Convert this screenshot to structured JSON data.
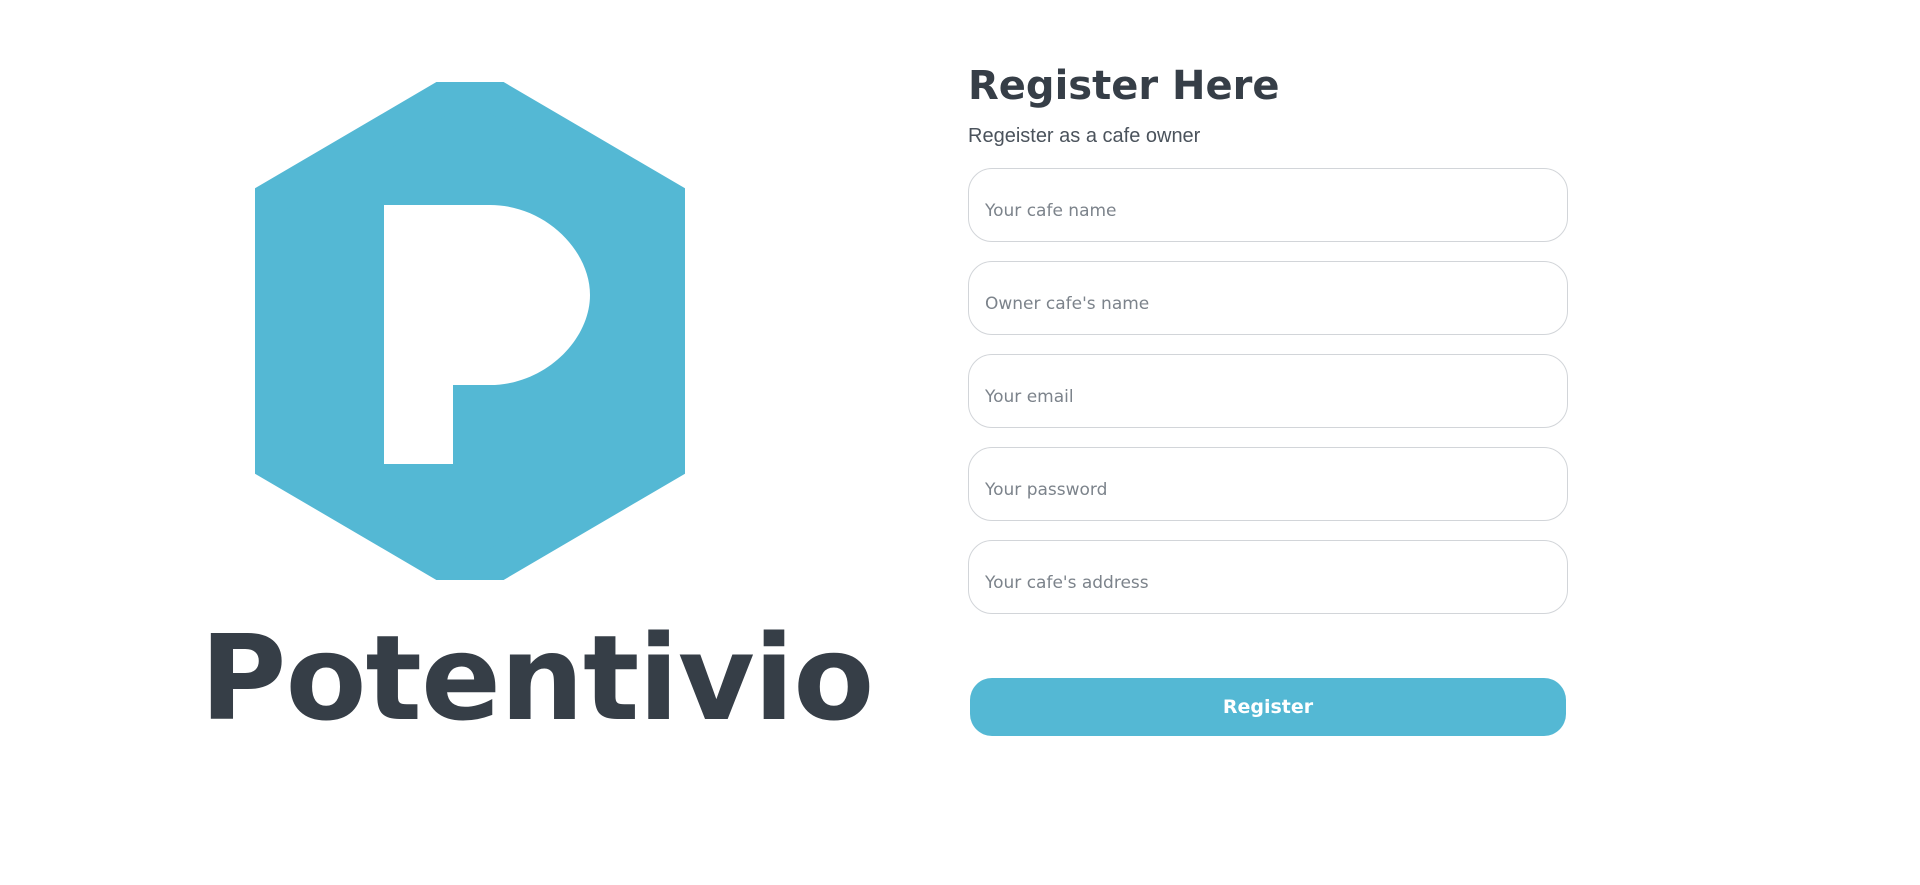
{
  "brand": {
    "name": "Potentivio",
    "logo_icon": "hexagon-p-logo",
    "logo_color": "#54b8d4",
    "text_color": "#363e47"
  },
  "form": {
    "title": "Register Here",
    "subtitle": "Regeister as a cafe owner",
    "fields": [
      {
        "placeholder": "Your cafe name",
        "value": ""
      },
      {
        "placeholder": "Owner cafe's name",
        "value": ""
      },
      {
        "placeholder": "Your email",
        "value": ""
      },
      {
        "placeholder": "Your password",
        "value": ""
      },
      {
        "placeholder": "Your cafe's address",
        "value": ""
      }
    ],
    "submit_label": "Register",
    "accent_color": "#54b8d4"
  }
}
